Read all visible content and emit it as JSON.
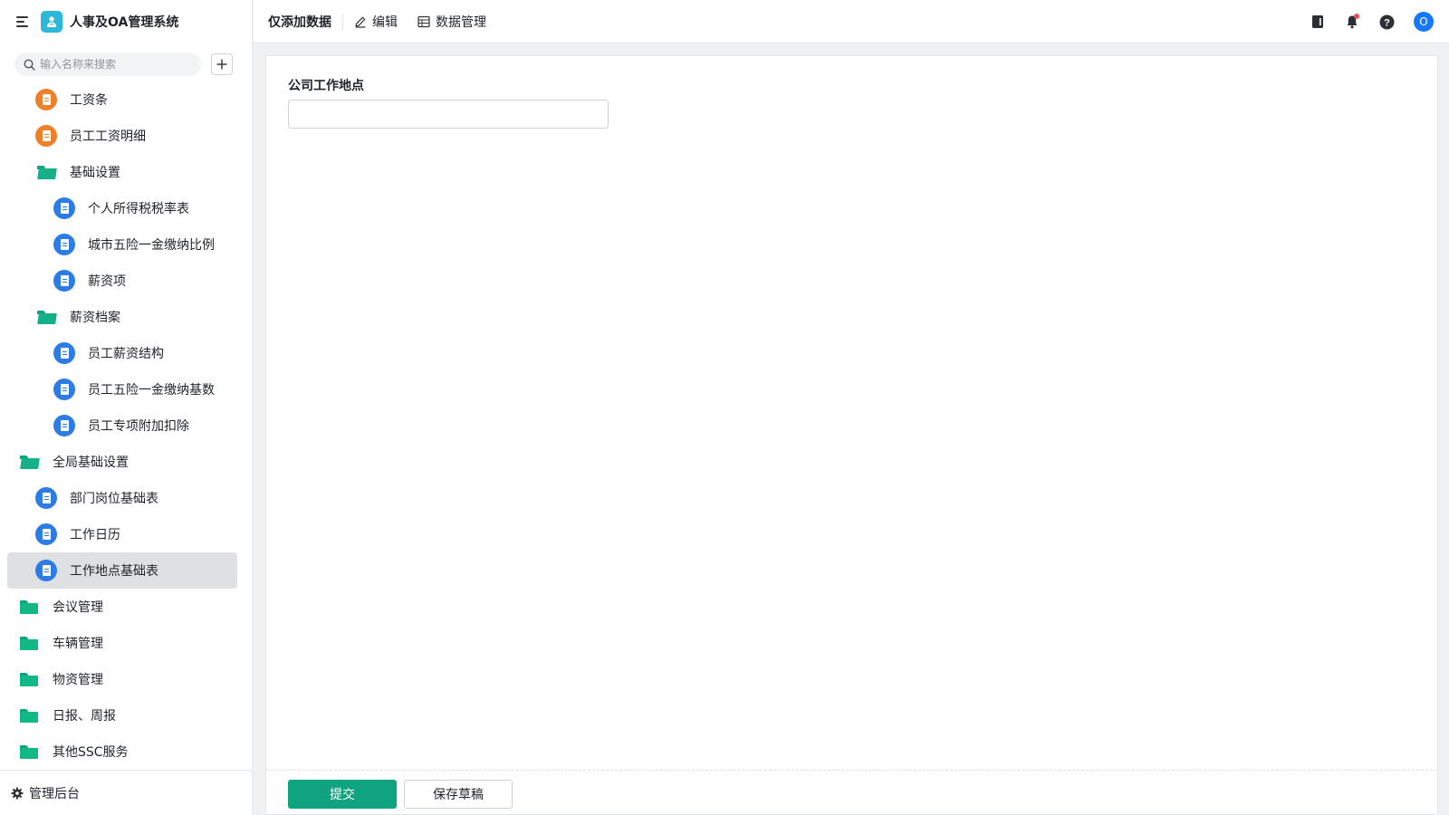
{
  "app": {
    "title": "人事及OA管理系统",
    "accent_color": "#10a37f",
    "logo_icon": "app-logo-icon"
  },
  "sidebar": {
    "search_placeholder": "输入名称来搜索",
    "add_icon": "plus-icon",
    "items": [
      {
        "label": "工资条",
        "type": "doc",
        "color": "orange"
      },
      {
        "label": "员工工资明细",
        "type": "doc",
        "color": "orange"
      },
      {
        "label": "基础设置",
        "type": "folder-open"
      },
      {
        "label": "个人所得税税率表",
        "type": "doc",
        "color": "blue"
      },
      {
        "label": "城市五险一金缴纳比例",
        "type": "doc",
        "color": "blue"
      },
      {
        "label": "薪资项",
        "type": "doc",
        "color": "blue"
      },
      {
        "label": "薪资档案",
        "type": "folder-open"
      },
      {
        "label": "员工薪资结构",
        "type": "doc",
        "color": "blue"
      },
      {
        "label": "员工五险一金缴纳基数",
        "type": "doc",
        "color": "blue"
      },
      {
        "label": "员工专项附加扣除",
        "type": "doc",
        "color": "blue"
      },
      {
        "label": "全局基础设置",
        "type": "folder-open"
      },
      {
        "label": "部门岗位基础表",
        "type": "doc",
        "color": "blue"
      },
      {
        "label": "工作日历",
        "type": "doc",
        "color": "blue"
      },
      {
        "label": "工作地点基础表",
        "type": "doc",
        "color": "blue",
        "active": true
      },
      {
        "label": "会议管理",
        "type": "folder"
      },
      {
        "label": "车辆管理",
        "type": "folder"
      },
      {
        "label": "物资管理",
        "type": "folder"
      },
      {
        "label": "日报、周报",
        "type": "folder"
      },
      {
        "label": "其他SSC服务",
        "type": "folder"
      }
    ],
    "footer_label": "管理后台"
  },
  "topbar": {
    "mode_title": "仅添加数据",
    "edit_label": "编辑",
    "data_manage_label": "数据管理",
    "right_icons": [
      "notebook-icon",
      "bell-icon",
      "help-icon"
    ],
    "avatar_letter": "O"
  },
  "form": {
    "field_label": "公司工作地点",
    "field_value": "",
    "submit_label": "提交",
    "draft_label": "保存草稿"
  }
}
